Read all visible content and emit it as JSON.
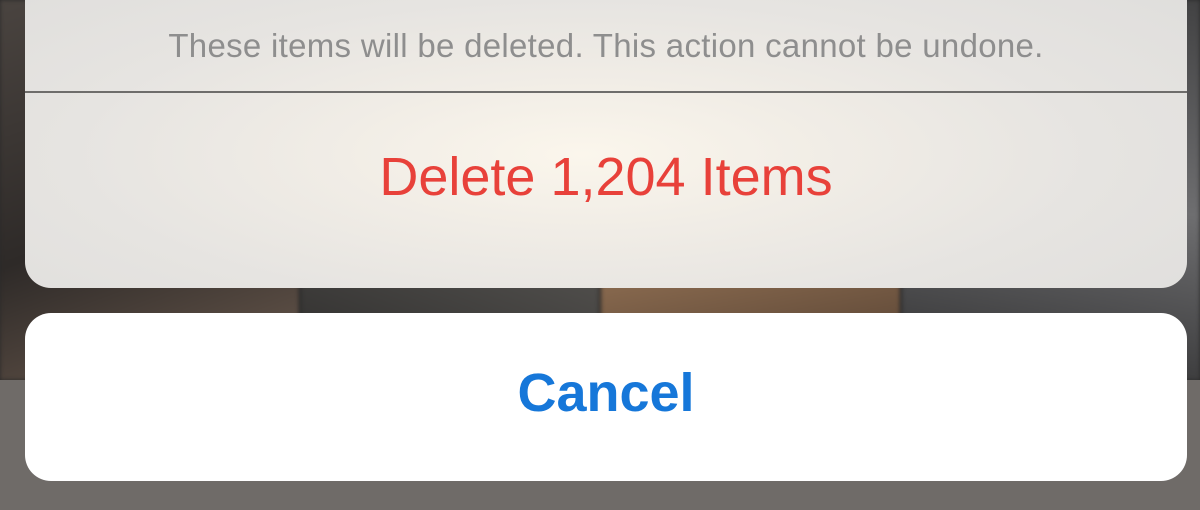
{
  "action_sheet": {
    "message": "These items will be deleted. This action cannot be undone.",
    "delete_label": "Delete 1,204 Items",
    "cancel_label": "Cancel"
  },
  "colors": {
    "destructive": "#e8413a",
    "cancel": "#1677d9",
    "message": "#8e8e8e"
  }
}
